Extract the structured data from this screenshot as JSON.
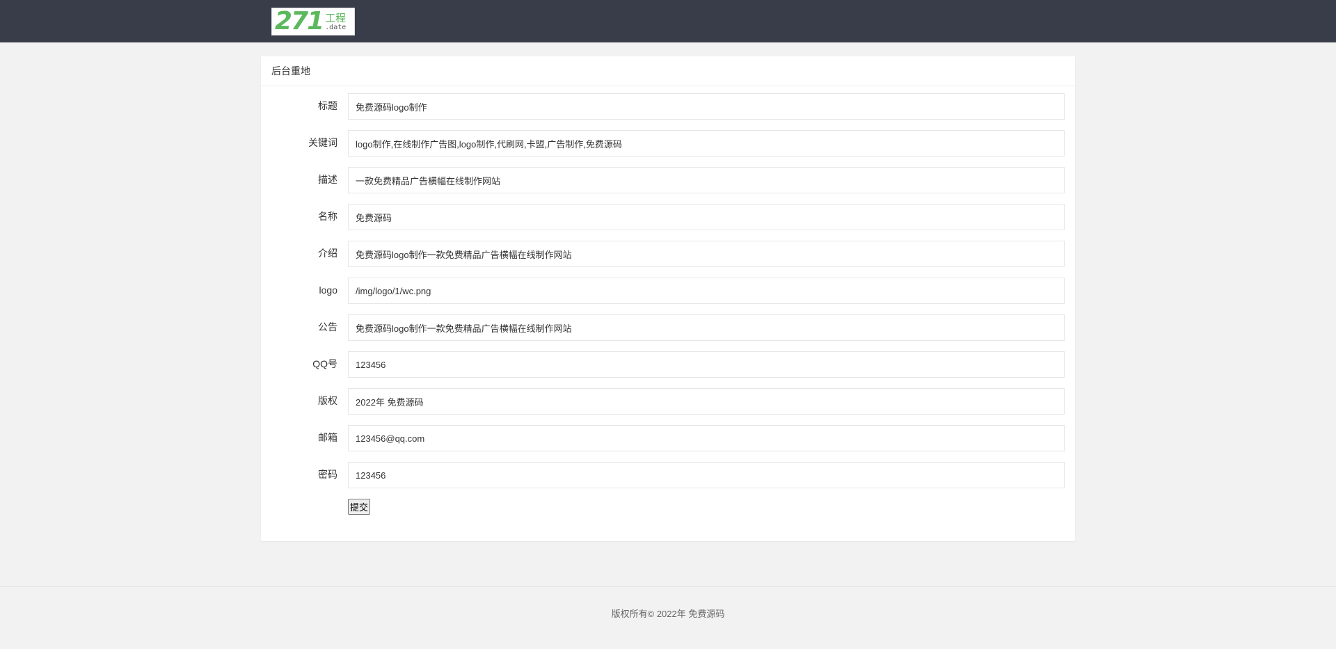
{
  "header": {
    "logo": {
      "number": "271",
      "cn": "工程",
      "domain": ".date"
    }
  },
  "card": {
    "title": "后台重地"
  },
  "form": {
    "fields": [
      {
        "label": "标题",
        "value": "免费源码logo制作"
      },
      {
        "label": "关键词",
        "value": "logo制作,在线制作广告图,logo制作,代刷网,卡盟,广告制作,免费源码"
      },
      {
        "label": "描述",
        "value": "一款免费精品广告横幅在线制作网站"
      },
      {
        "label": "名称",
        "value": "免费源码"
      },
      {
        "label": "介绍",
        "value": "免费源码logo制作一款免费精品广告横幅在线制作网站"
      },
      {
        "label": "logo",
        "value": "/img/logo/1/wc.png"
      },
      {
        "label": "公告",
        "value": "免费源码logo制作一款免费精品广告横幅在线制作网站"
      },
      {
        "label": "QQ号",
        "value": "123456"
      },
      {
        "label": "版权",
        "value": "2022年 免费源码"
      },
      {
        "label": "邮箱",
        "value": "123456@qq.com"
      },
      {
        "label": "密码",
        "value": "123456"
      }
    ],
    "submit_label": "提交"
  },
  "footer": {
    "text": "版权所有© 2022年 免费源码"
  }
}
